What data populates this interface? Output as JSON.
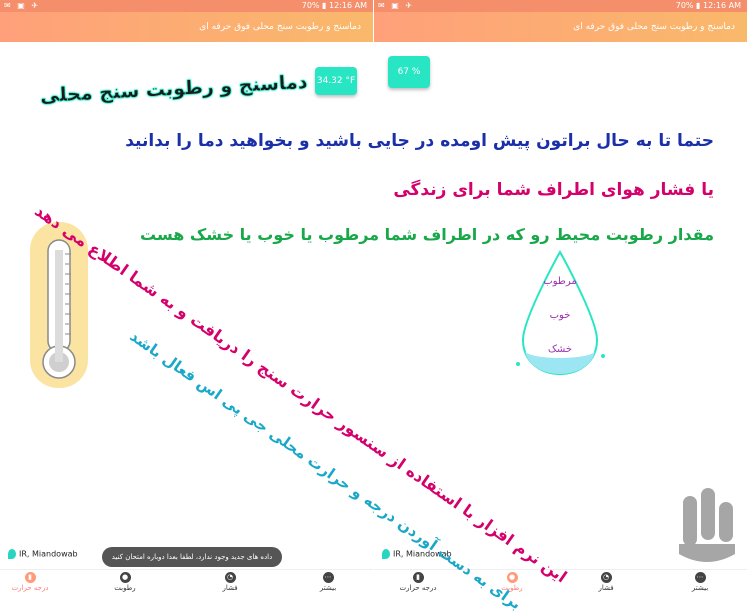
{
  "status_bar": {
    "time": "12:16 AM",
    "battery": "70%"
  },
  "app": {
    "title": "دماسنج و رطوبت سنج محلی فوق حرفه ای"
  },
  "left_screen": {
    "logo_text": "دماسنج و رطوبت سنج محلی",
    "temperature": "34.32 °F",
    "location": "IR, Miandowab",
    "toast": "داده های جدید وجود ندارد، لطفا بعدا دوباره امتحان کنید"
  },
  "right_screen": {
    "humidity": "67 %",
    "location": "IR, Miandowab",
    "drop_labels": {
      "humid": "مرطوب",
      "good": "خوب",
      "dry": "خشک"
    }
  },
  "nav": {
    "items": [
      {
        "label": "درجه حرارت"
      },
      {
        "label": "رطوبت"
      },
      {
        "label": "فشار"
      },
      {
        "label": "بیشتر"
      }
    ]
  },
  "promo": {
    "line1": "حتما تا به حال براتون پیش اومده در جایی باشید و بخواهید دما را بدانید",
    "line2": "یا فشار هوای اطراف شما برای زندگی",
    "line3": "مقدار رطوبت محیط رو که در اطراف شما مرطوب یا خوب یا خشک هست",
    "diag1": "این نرم افزار با استفاده از سنسور حرارت سنج را دریافت و به شما اطلاع می دهد",
    "diag2": "برای به دست آوردن درجه و حرارت محلی جی پی اس فعال باشد"
  },
  "colors": {
    "accent": "#f58f6b",
    "teal": "#28e6c4",
    "promo_blue": "#1a2fa8",
    "promo_magenta": "#d4006b",
    "promo_green": "#18a84a"
  }
}
